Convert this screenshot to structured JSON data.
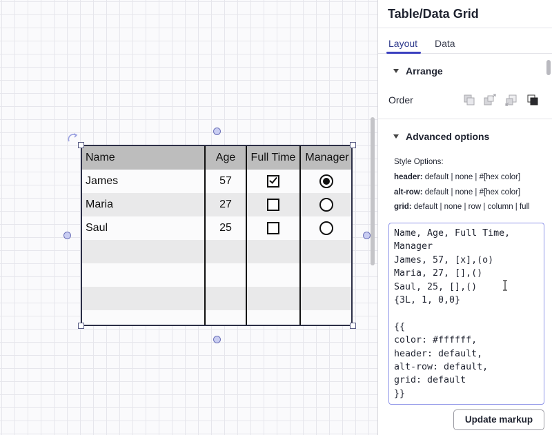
{
  "panel": {
    "title": "Table/Data Grid",
    "tabs": [
      {
        "label": "Layout",
        "active": true
      },
      {
        "label": "Data",
        "active": false
      }
    ],
    "arrange": {
      "heading": "Arrange",
      "order_label": "Order",
      "order_icons": [
        "bring-forward-icon",
        "bring-to-front-icon",
        "send-backward-icon",
        "send-to-back-icon"
      ]
    },
    "advanced": {
      "heading": "Advanced options",
      "style_title": "Style Options:",
      "options": [
        {
          "key": "header:",
          "value": " default | none | #[hex color]"
        },
        {
          "key": "alt-row:",
          "value": " default | none | #[hex color]"
        },
        {
          "key": "grid:",
          "value": " default | none | row | column | full"
        }
      ],
      "markup": "Name, Age, Full Time,\nManager\nJames, 57, [x],(o)\nMaria, 27, [],()\nSaul, 25, [],()\n{3L, 1, 0,0}\n\n{{\ncolor: #ffffff,\nheader: default,\nalt-row: default,\ngrid: default\n}}",
      "update_button": "Update markup"
    }
  },
  "table": {
    "headers": [
      "Name",
      "Age",
      "Full Time",
      "Manager"
    ],
    "rows": [
      {
        "name": "James",
        "age": "57",
        "full_time": true,
        "manager": true
      },
      {
        "name": "Maria",
        "age": "27",
        "full_time": false,
        "manager": false
      },
      {
        "name": "Saul",
        "age": "25",
        "full_time": false,
        "manager": false
      }
    ],
    "empty_rows": 4
  },
  "colors": {
    "header_bg": "#bdbdbd",
    "alt_row_bg": "#e9e9ea",
    "accent": "#3a3fbf",
    "selection_handle": "#c9cdf2"
  }
}
